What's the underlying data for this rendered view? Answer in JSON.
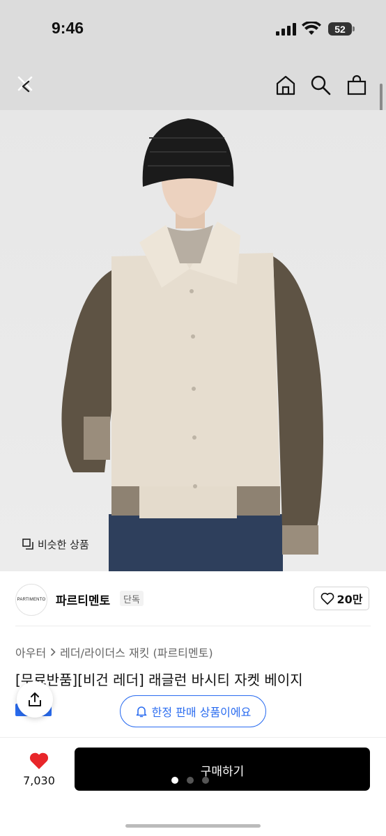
{
  "status_bar": {
    "time": "9:46",
    "battery": "52"
  },
  "nav": {
    "back_icon": "close-back-icon",
    "home_icon": "home-icon",
    "search_icon": "search-icon",
    "cart_icon": "shopping-bag-icon"
  },
  "image": {
    "similar_label": "비슷한 상품"
  },
  "brand": {
    "logo_text": "PARTIMENTO",
    "name": "파르티멘토",
    "badge": "단독",
    "likes": "20만"
  },
  "breadcrumb": {
    "category": "아우터",
    "subcategory": "레더/라이더스 재킷 (파르티멘토)"
  },
  "product": {
    "title": "[무료반품][비건 레더] 래글런 바시티 자켓 베이지"
  },
  "overlay": {
    "limited_label": "한정 판매 상품이에요"
  },
  "bottom": {
    "wish_count": "7,030",
    "buy_label": "구매하기"
  },
  "colors": {
    "accent": "#2a6cf0",
    "heart": "#e8262a",
    "buy_bg": "#000000"
  }
}
